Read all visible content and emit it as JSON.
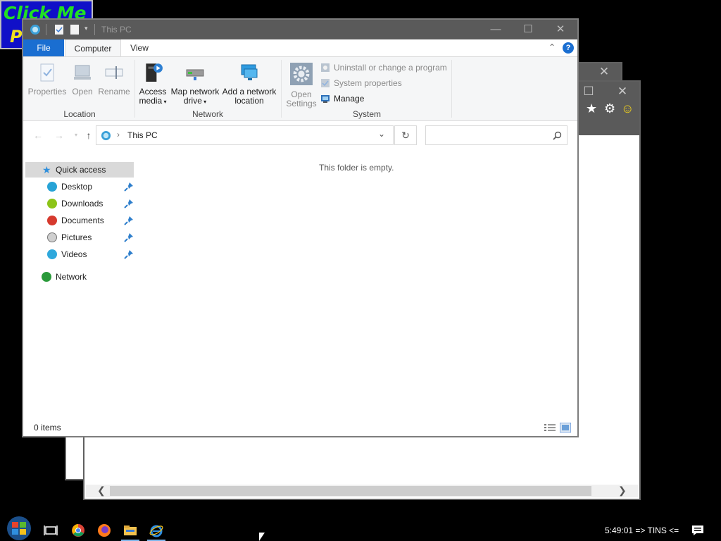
{
  "banner": {
    "line1": "Click Me",
    "line2": "P"
  },
  "window": {
    "title": "This PC"
  },
  "tabs": {
    "file": "File",
    "computer": "Computer",
    "view": "View"
  },
  "ribbon": {
    "location": {
      "label": "Location",
      "properties": "Properties",
      "open": "Open",
      "rename": "Rename"
    },
    "network": {
      "label": "Network",
      "access_media_1": "Access",
      "access_media_2": "media",
      "map_drive_1": "Map network",
      "map_drive_2": "drive",
      "add_location_1": "Add a network",
      "add_location_2": "location"
    },
    "system": {
      "label": "System",
      "open_settings_1": "Open",
      "open_settings_2": "Settings",
      "uninstall": "Uninstall or change a program",
      "system_properties": "System properties",
      "manage": "Manage"
    }
  },
  "address": {
    "path": "This PC",
    "search_placeholder": ""
  },
  "nav": {
    "quick_access": "Quick access",
    "items": [
      {
        "label": "Desktop"
      },
      {
        "label": "Downloads"
      },
      {
        "label": "Documents"
      },
      {
        "label": "Pictures"
      },
      {
        "label": "Videos"
      }
    ],
    "network": "Network"
  },
  "content": {
    "empty_message": "This folder is empty."
  },
  "status": {
    "item_count": "0 items"
  },
  "taskbar": {
    "clock": "5:49:01 => TINS <="
  },
  "colors": {
    "accent": "#1a6ed1",
    "titlebar": "#5a5a5a",
    "desktop": "#000000"
  }
}
